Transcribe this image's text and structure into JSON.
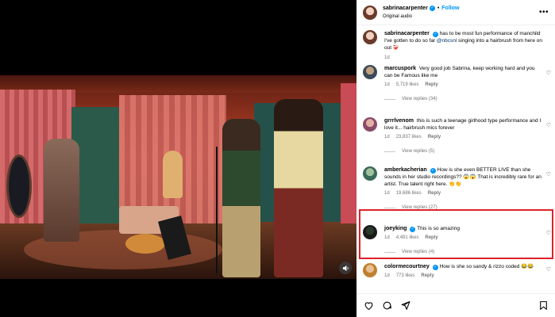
{
  "post": {
    "username": "sabrinacarpenter",
    "follow_label": "Follow",
    "subtitle": "Original audio",
    "more": "•••"
  },
  "caption": {
    "username": "sabrinacarpenter",
    "text_before": "has to be most fun performance of manchild I've gotten to do so far ",
    "mention": "@nbcsnl",
    "text_after": " singing into a hairbrush from here on out",
    "emoji": "❤️‍🩹",
    "time": "1d"
  },
  "comments": [
    {
      "username": "marcuspork",
      "verified": false,
      "text": "Very good job Sabrina, keep working hard and you can be Famous like me",
      "time": "1d",
      "likes": "5,719 likes",
      "reply": "Reply",
      "view_replies": "View replies (34)"
    },
    {
      "username": "grrrlvenom",
      "verified": false,
      "text": "this is such a teenage girlhood type performance and I love it... hairbrush mics forever",
      "time": "1d",
      "likes": "23,837 likes",
      "reply": "Reply",
      "view_replies": "View replies (5)"
    },
    {
      "username": "amberkacherian",
      "verified": true,
      "text": "How is she even BETTER LIVE than she sounds in her studio recordings?? 😱😱 That is incredibly rare for an artist. True talent right here. 👏👏",
      "time": "1d",
      "likes": "19,686 likes",
      "reply": "Reply",
      "view_replies": "View replies (27)"
    },
    {
      "username": "joeyking",
      "verified": true,
      "text": "This is so amazing",
      "time": "1d",
      "likes": "4,491 likes",
      "reply": "Reply",
      "view_replies": "View replies (4)"
    },
    {
      "username": "colormecourtney",
      "verified": true,
      "text": "How is she so sandy & rizzo coded 😂😂",
      "time": "1d",
      "likes": "773 likes",
      "reply": "Reply",
      "view_replies": ""
    }
  ],
  "icons": {
    "heart": "heart-icon",
    "comment": "comment-icon",
    "share": "share-icon",
    "bookmark": "bookmark-icon",
    "mute": "speaker-icon"
  },
  "colors": {
    "accent": "#0095f6",
    "highlight": "#e0202a"
  }
}
